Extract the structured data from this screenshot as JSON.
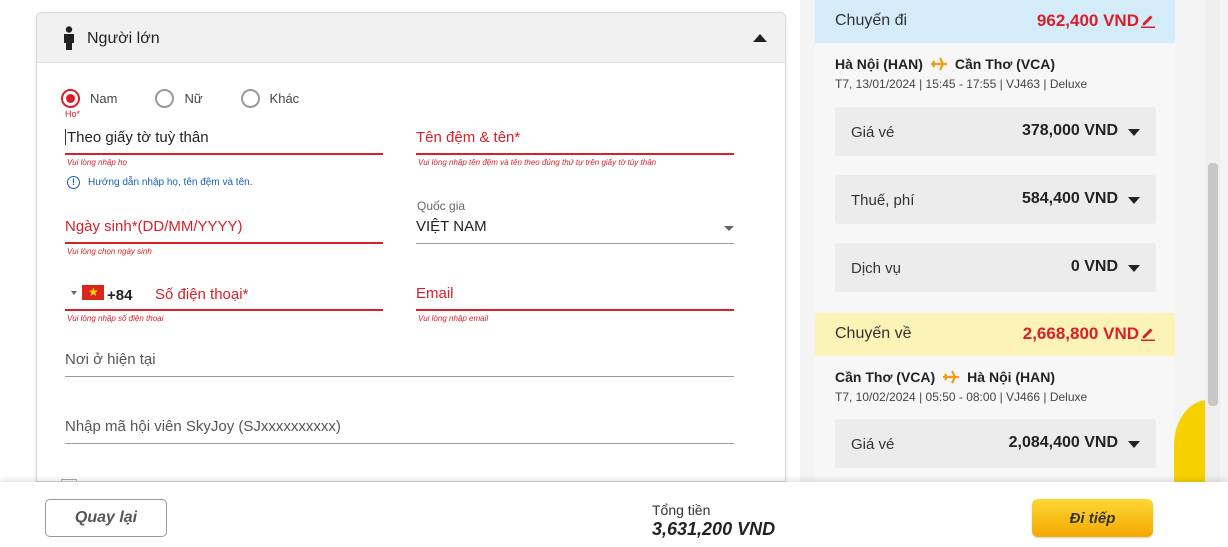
{
  "passenger": {
    "title": "Người lớn",
    "gender": {
      "options": [
        "Nam",
        "Nữ",
        "Khác"
      ],
      "selected": "Nam"
    },
    "surname": {
      "label": "Họ*",
      "placeholder": "Theo giấy tờ tuỳ thân",
      "error": "Vui lòng nhập họ"
    },
    "given_name": {
      "label": "Tên đệm & tên*",
      "error": "Vui lòng nhập tên đệm và tên theo đúng thứ tự trên giấy tờ tùy thân"
    },
    "name_hint": "Hướng dẫn nhập họ, tên đệm và tên.",
    "dob": {
      "label": "Ngày sinh*(DD/MM/YYYY)",
      "error": "Vui lòng chọn ngày sinh"
    },
    "country": {
      "label": "Quốc gia",
      "value": "VIỆT NAM"
    },
    "phone": {
      "dial_code": "+84",
      "label": "Số điện thoại*",
      "error": "Vui lòng nhập số điện thoại"
    },
    "email": {
      "label": "Email",
      "error": "Vui lòng nhập email"
    },
    "address": {
      "label": "Nơi ở hiện tại"
    },
    "membership": {
      "label": "Nhập mã hội viên SkyJoy (SJxxxxxxxxxx)"
    }
  },
  "summary": {
    "outbound": {
      "heading": "Chuyến đi",
      "total": "962,400 VND",
      "from": "Hà Nội (HAN)",
      "to": "Cần Thơ (VCA)",
      "meta": "T7, 13/01/2024 | 15:45 - 17:55 | VJ463 | Deluxe",
      "rows": [
        {
          "label": "Giá vé",
          "amount": "378,000 VND"
        },
        {
          "label": "Thuế, phí",
          "amount": "584,400 VND"
        },
        {
          "label": "Dịch vụ",
          "amount": "0 VND"
        }
      ]
    },
    "return": {
      "heading": "Chuyến về",
      "total": "2,668,800 VND",
      "from": "Cần Thơ (VCA)",
      "to": "Hà Nội (HAN)",
      "meta": "T7, 10/02/2024 | 05:50 - 08:00 | VJ466 | Deluxe",
      "rows": [
        {
          "label": "Giá vé",
          "amount": "2,084,400 VND"
        }
      ]
    }
  },
  "footer": {
    "back_label": "Quay lại",
    "total_label": "Tổng tiền",
    "total_value": "3,631,200 VND",
    "next_label": "Đi tiếp"
  },
  "colors": {
    "accent_red": "#d9202a",
    "outbound_header": "#d4ecfa",
    "return_header": "#fcf3b6",
    "next_button": "#f5b800",
    "plane_orange": "#f39c12"
  },
  "icons": [
    "person-icon",
    "chevron-up-icon",
    "info-icon",
    "vietnam-flag-icon",
    "dropdown-caret-icon",
    "plane-icon",
    "pencil-icon",
    "chevron-down-icon"
  ]
}
